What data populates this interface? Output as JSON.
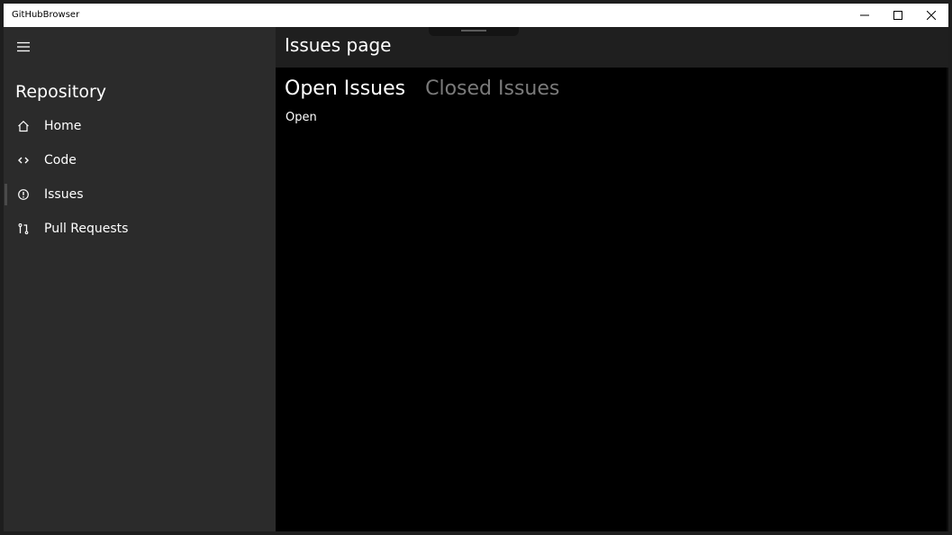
{
  "window": {
    "title": "GitHubBrowser",
    "minimize_icon": "minimize-icon",
    "maximize_icon": "maximize-icon",
    "close_icon": "close-icon"
  },
  "nav": {
    "menu_icon": "hamburger-menu-icon",
    "header": "Repository",
    "items": [
      {
        "label": "Home",
        "icon": "home-icon",
        "selected": false
      },
      {
        "label": "Code",
        "icon": "code-icon",
        "selected": false
      },
      {
        "label": "Issues",
        "icon": "issue-icon",
        "selected": true
      },
      {
        "label": "Pull Requests",
        "icon": "pull-request-icon",
        "selected": false
      }
    ]
  },
  "content": {
    "page_title": "Issues page",
    "tabs": [
      {
        "label": "Open Issues",
        "active": true
      },
      {
        "label": "Closed Issues",
        "active": false
      }
    ],
    "body_text": "Open"
  },
  "colors": {
    "nav_background": "#2b2b2b",
    "content_background": "#000000",
    "header_background": "#1f1f1f",
    "inactive_tab": "#7a7a7a",
    "text": "#ffffff"
  }
}
